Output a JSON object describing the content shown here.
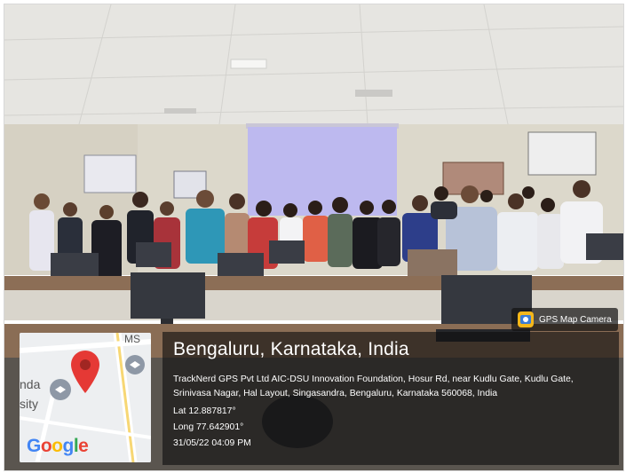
{
  "overlay": {
    "location_title": "Bengaluru, Karnataka, India",
    "address": "TrackNerd GPS Pvt Ltd AIC-DSU Innovation Foundation, Hosur Rd, near Kudlu Gate, Kudlu Gate, Srinivasa Nagar, Hal Layout, Singasandra, Bengaluru, Karnataka 560068, India",
    "lat": "Lat 12.887817°",
    "long": "Long 77.642901°",
    "datetime": "31/05/22 04:09 PM"
  },
  "badge": {
    "label": "GPS Map Camera",
    "icon": "gps-map-camera-icon"
  },
  "map": {
    "labels": {
      "top": "MS",
      "left_1": "nda",
      "left_2": "sity"
    },
    "logo_letters": [
      "G",
      "o",
      "o",
      "g",
      "l",
      "e"
    ],
    "pin_color": "#E53935",
    "icon": "location-pin-icon"
  },
  "colors": {
    "wall": "#d9d6cc",
    "ceiling": "#e9e8e4",
    "projection_screen": "#bcb9ef",
    "desk": "#8a6e55",
    "overlay_bg": "#1a1a1a"
  }
}
